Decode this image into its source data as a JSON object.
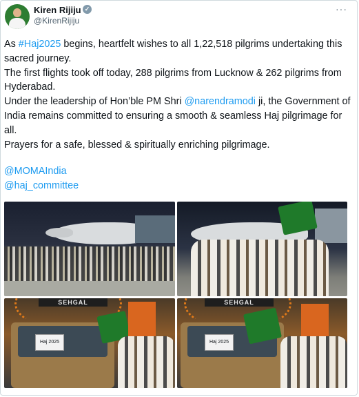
{
  "author": {
    "name": "Kiren Rijiju",
    "handle": "@KirenRijiju",
    "verified_icon": "verified-badge-icon"
  },
  "more_label": "···",
  "tweet": {
    "line1_pre": "As ",
    "line1_tag": "#Haj2025",
    "line1_post": " begins, heartfelt wishes to all 1,22,518 pilgrims undertaking this sacred journey.",
    "line2": "The first flights took off today, 288 pilgrims from Lucknow & 262 pilgrims from Hyderabad.",
    "line3_pre": "Under the leadership of Hon’ble PM Shri ",
    "line3_mention": "@narendramodi",
    "line3_post": " ji, the Government of India remains committed to ensuring a smooth & seamless Haj pilgrimage for all.",
    "line4": "Prayers for a safe, blessed & spiritually enriching pilgrimage."
  },
  "mentions": [
    "@MOMAIndia",
    "@haj_committee"
  ],
  "photos": {
    "bus_banner": "SEHGAL",
    "bus_sign": "Haj 2025"
  },
  "colors": {
    "link": "#1d9bf0",
    "text": "#0f1419",
    "muted": "#536471",
    "border": "#cfd9de"
  }
}
